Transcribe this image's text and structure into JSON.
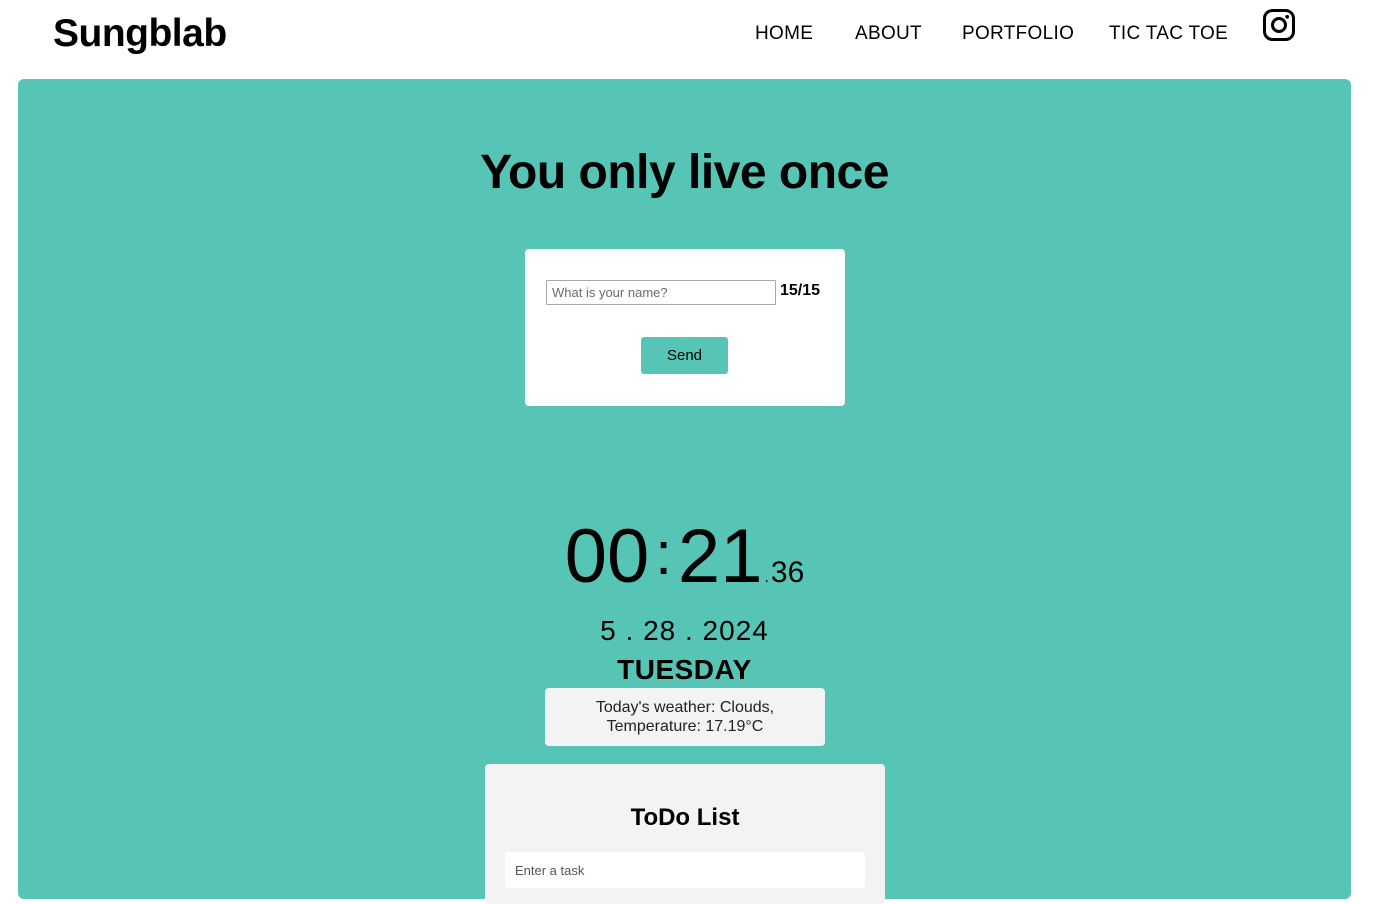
{
  "header": {
    "logo": "Sungblab",
    "nav": [
      "HOME",
      "ABOUT",
      "PORTFOLIO",
      "TIC TAC TOE"
    ],
    "social_icon": "instagram-icon"
  },
  "hero": {
    "title": "You only live once"
  },
  "name_form": {
    "placeholder": "What is your name?",
    "counter": "15/15",
    "send_label": "Send"
  },
  "clock": {
    "hours": "00",
    "separator": ":",
    "minutes": "21",
    "dot": ".",
    "seconds": "36",
    "date": "5 . 28 . 2024",
    "day": "TUESDAY"
  },
  "weather": {
    "line1": "Today's weather: Clouds,",
    "line2": "Temperature: 17.19°C"
  },
  "todo": {
    "title": "ToDo List",
    "placeholder": "Enter a task"
  },
  "colors": {
    "accent": "#57c5b6",
    "card": "#ffffff",
    "panel": "#f3f3f3"
  }
}
